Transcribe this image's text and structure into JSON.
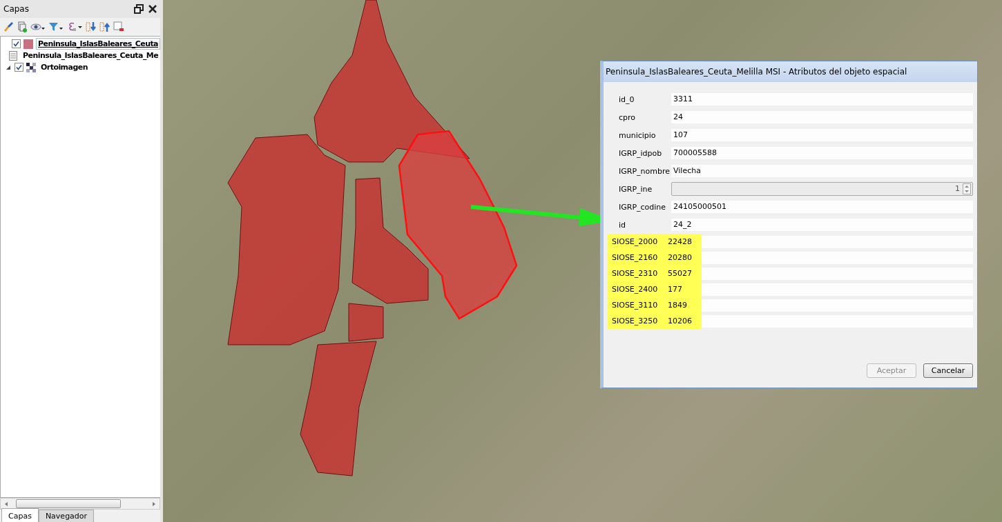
{
  "layers_panel": {
    "title": "Capas",
    "layers": [
      {
        "kind": "vector",
        "label": "Peninsula_IslasBaleares_Ceuta",
        "checked": true,
        "selected": true,
        "color": "#c87080"
      },
      {
        "kind": "table",
        "label": "Peninsula_IslasBaleares_Ceuta_Me",
        "selected": false
      },
      {
        "kind": "raster",
        "label": "Ortoimagen",
        "checked": true,
        "selected": false
      }
    ],
    "tabs": [
      {
        "label": "Capas",
        "selected": true
      },
      {
        "label": "Navegador",
        "selected": false
      }
    ]
  },
  "dialog": {
    "title": "Peninsula_IslasBaleares_Ceuta_Melilla MSI - Atributos del objeto espacial",
    "fields": [
      {
        "kind": "text",
        "label": "id_0",
        "value": "3311",
        "disabled": false,
        "highlighted": false
      },
      {
        "kind": "text",
        "label": "cpro",
        "value": "24",
        "disabled": false,
        "highlighted": false
      },
      {
        "kind": "text",
        "label": "municipio",
        "value": "107",
        "disabled": false,
        "highlighted": false
      },
      {
        "kind": "text",
        "label": "IGRP_idpob",
        "value": "700005588",
        "disabled": false,
        "highlighted": false
      },
      {
        "kind": "text",
        "label": "IGRP_nombre",
        "value": "Vilecha",
        "disabled": false,
        "highlighted": false
      },
      {
        "kind": "spinbox",
        "label": "IGRP_ine",
        "value": "1",
        "disabled": true,
        "highlighted": false
      },
      {
        "kind": "text",
        "label": "IGRP_codine",
        "value": "24105000501",
        "disabled": false,
        "highlighted": false
      },
      {
        "kind": "text",
        "label": "id",
        "value": "24_2",
        "disabled": false,
        "highlighted": false
      },
      {
        "kind": "text",
        "label": "SIOSE_2000",
        "value": "22428",
        "disabled": false,
        "highlighted": true
      },
      {
        "kind": "text",
        "label": "SIOSE_2160",
        "value": "20280",
        "disabled": false,
        "highlighted": true
      },
      {
        "kind": "text",
        "label": "SIOSE_2310",
        "value": "55027",
        "disabled": false,
        "highlighted": true
      },
      {
        "kind": "text",
        "label": "SIOSE_2400",
        "value": "177",
        "disabled": false,
        "highlighted": true
      },
      {
        "kind": "text",
        "label": "SIOSE_3110",
        "value": "1849",
        "disabled": false,
        "highlighted": true
      },
      {
        "kind": "text",
        "label": "SIOSE_3250",
        "value": "10206",
        "disabled": false,
        "highlighted": true
      }
    ],
    "buttons": [
      {
        "label": "Aceptar",
        "disabled": true
      },
      {
        "label": "Cancelar",
        "disabled": false
      }
    ]
  }
}
